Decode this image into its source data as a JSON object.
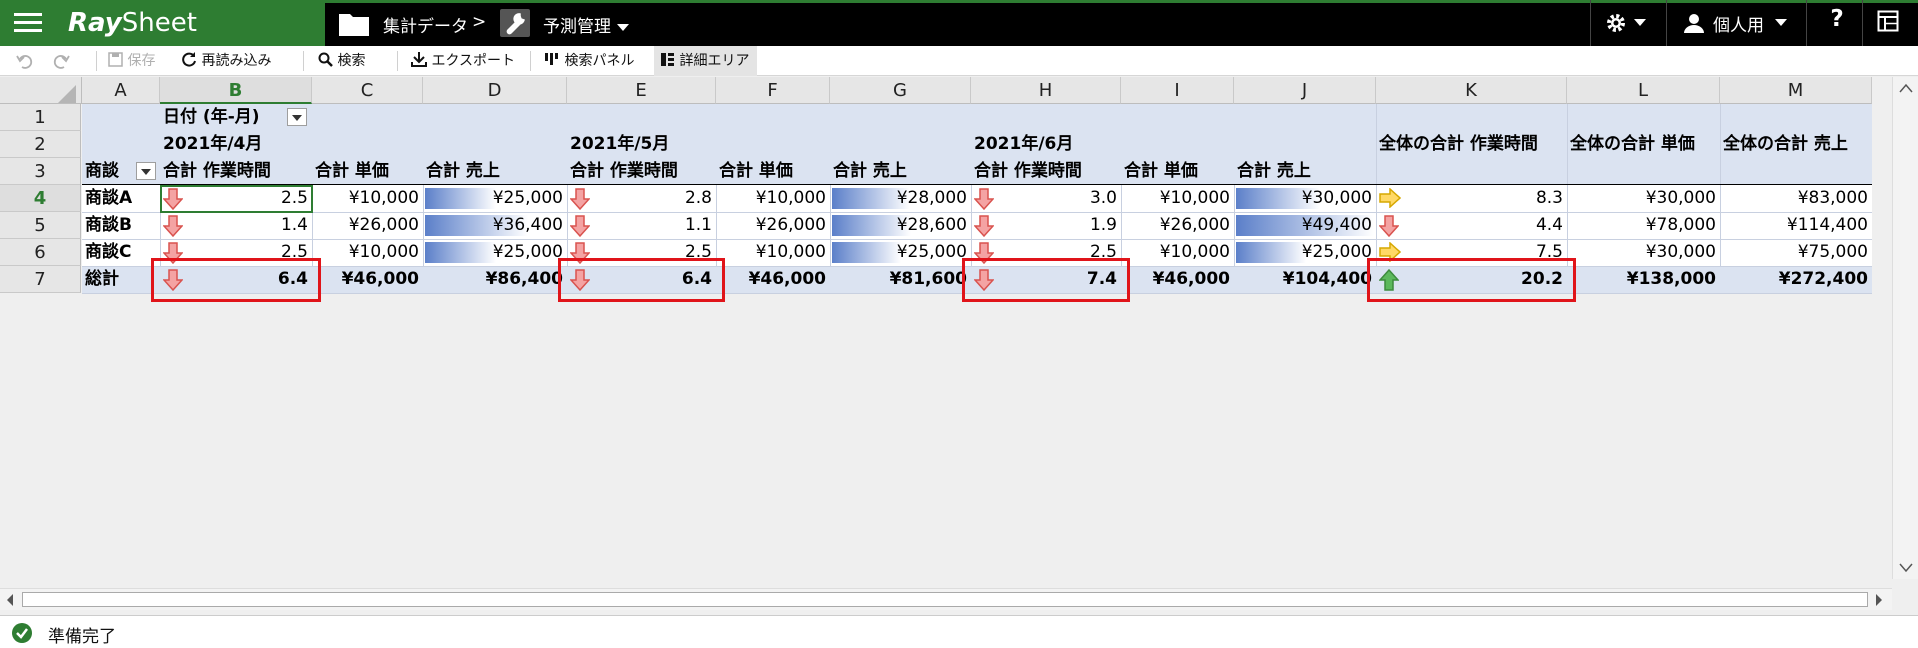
{
  "app": {
    "brand_ray": "Ray",
    "brand_sheet": "Sheet",
    "breadcrumb_folder": "集計データ",
    "breadcrumb_sep": ">",
    "breadcrumb_current": "予測管理",
    "user_label": "個人用",
    "help_label": "?"
  },
  "toolbar": {
    "save": "保存",
    "reload": "再読み込み",
    "search": "検索",
    "export": "エクスポート",
    "search_panel": "検索パネル",
    "detail_area": "詳細エリア"
  },
  "columns": [
    "A",
    "B",
    "C",
    "D",
    "E",
    "F",
    "G",
    "H",
    "I",
    "J",
    "K",
    "L",
    "M"
  ],
  "rows": [
    "1",
    "2",
    "3",
    "4",
    "5",
    "6",
    "7"
  ],
  "pivot": {
    "date_field": "日付 (年-月)",
    "row_field": "商談",
    "periods": [
      "2021年/4月",
      "2021年/5月",
      "2021年/6月"
    ],
    "measure_headers": [
      "合計 作業時間",
      "合計 単価",
      "合計 売上"
    ],
    "grand_headers": [
      "全体の合計 作業時間",
      "全体の合計 単価",
      "全体の合計 売上"
    ],
    "data_rows": [
      {
        "name": "商談A",
        "cells": [
          "2.5",
          "¥10,000",
          "¥25,000",
          "2.8",
          "¥10,000",
          "¥28,000",
          "3.0",
          "¥10,000",
          "¥30,000",
          "8.3",
          "¥30,000",
          "¥83,000"
        ]
      },
      {
        "name": "商談B",
        "cells": [
          "1.4",
          "¥26,000",
          "¥36,400",
          "1.1",
          "¥26,000",
          "¥28,600",
          "1.9",
          "¥26,000",
          "¥49,400",
          "4.4",
          "¥78,000",
          "¥114,400"
        ]
      },
      {
        "name": "商談C",
        "cells": [
          "2.5",
          "¥10,000",
          "¥25,000",
          "2.5",
          "¥10,000",
          "¥25,000",
          "2.5",
          "¥10,000",
          "¥25,000",
          "7.5",
          "¥30,000",
          "¥75,000"
        ]
      }
    ],
    "total_row": {
      "name": "総計",
      "cells": [
        "6.4",
        "¥46,000",
        "¥86,400",
        "6.4",
        "¥46,000",
        "¥81,600",
        "7.4",
        "¥46,000",
        "¥104,400",
        "20.2",
        "¥138,000",
        "¥272,400"
      ]
    }
  },
  "status": {
    "text": "準備完了"
  },
  "colors": {
    "brand_green": "#2e7d32",
    "pivot_header": "#dbe3f1",
    "highlight_red": "#e0141a",
    "databar_blue": "#5b7fc9"
  },
  "icons": {
    "menu": "hamburger-icon",
    "folder": "folder-icon",
    "wrench": "wrench-icon",
    "settings": "gear-icon",
    "user": "user-icon",
    "help": "question-icon",
    "grid": "grid-icon",
    "undo": "undo-icon",
    "redo": "redo-icon",
    "save": "save-icon",
    "reload": "reload-icon",
    "search": "search-icon",
    "export": "download-icon",
    "search_panel": "panel-icon",
    "detail_area": "detail-icon",
    "trend_down": "red-down-arrow-icon",
    "trend_flat": "yellow-right-arrow-icon",
    "trend_up": "green-up-arrow-icon",
    "status_ok": "check-circle-icon"
  }
}
